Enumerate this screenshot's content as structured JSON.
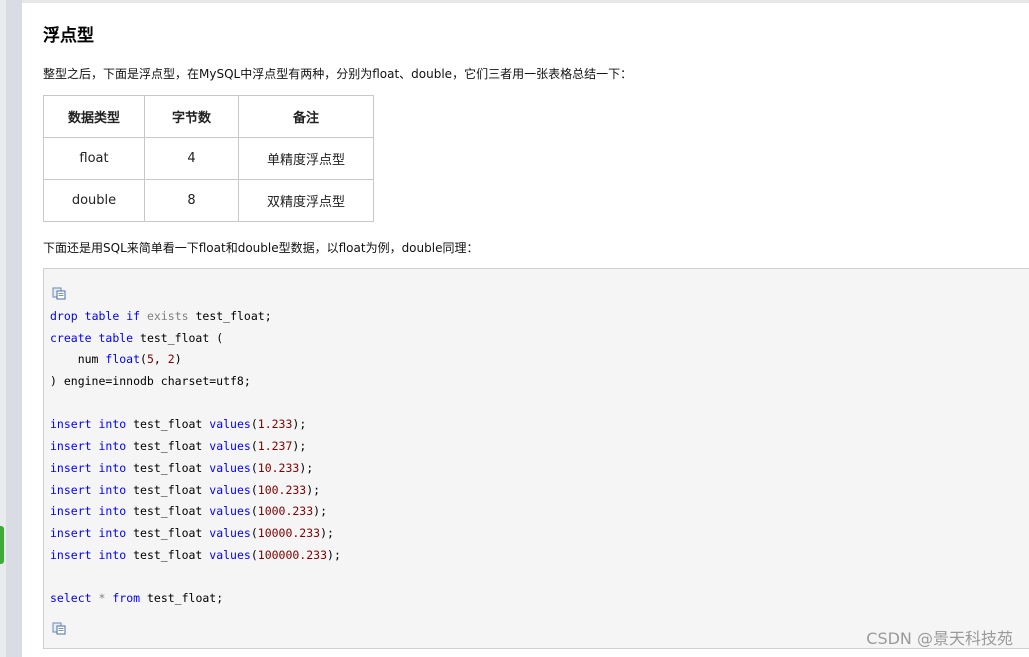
{
  "heading": "浮点型",
  "intro": "整型之后，下面是浮点型，在MySQL中浮点型有两种，分别为float、double，它们三者用一张表格总结一下：",
  "table": {
    "headers": [
      "数据类型",
      "字节数",
      "备注"
    ],
    "rows": [
      [
        "float",
        "4",
        "单精度浮点型"
      ],
      [
        "double",
        "8",
        "双精度浮点型"
      ]
    ]
  },
  "para2": "下面还是用SQL来简单看一下float和double型数据，以float为例，double同理：",
  "code": {
    "lines": [
      [
        {
          "t": "drop",
          "c": "kw"
        },
        {
          "t": " "
        },
        {
          "t": "table",
          "c": "kw"
        },
        {
          "t": " "
        },
        {
          "t": "if",
          "c": "kw"
        },
        {
          "t": " "
        },
        {
          "t": "exists",
          "c": "gray"
        },
        {
          "t": " test_float;"
        }
      ],
      [
        {
          "t": "create",
          "c": "kw"
        },
        {
          "t": " "
        },
        {
          "t": "table",
          "c": "kw"
        },
        {
          "t": " test_float ("
        }
      ],
      [
        {
          "t": "    num "
        },
        {
          "t": "float",
          "c": "kw"
        },
        {
          "t": "("
        },
        {
          "t": "5",
          "c": "num"
        },
        {
          "t": ", "
        },
        {
          "t": "2",
          "c": "num"
        },
        {
          "t": ")"
        }
      ],
      [
        {
          "t": ") engine=innodb charset=utf8;"
        }
      ],
      [],
      [
        {
          "t": "insert",
          "c": "kw"
        },
        {
          "t": " "
        },
        {
          "t": "into",
          "c": "kw"
        },
        {
          "t": " test_float "
        },
        {
          "t": "values",
          "c": "kw"
        },
        {
          "t": "("
        },
        {
          "t": "1.233",
          "c": "num"
        },
        {
          "t": ");"
        }
      ],
      [
        {
          "t": "insert",
          "c": "kw"
        },
        {
          "t": " "
        },
        {
          "t": "into",
          "c": "kw"
        },
        {
          "t": " test_float "
        },
        {
          "t": "values",
          "c": "kw"
        },
        {
          "t": "("
        },
        {
          "t": "1.237",
          "c": "num"
        },
        {
          "t": ");"
        }
      ],
      [
        {
          "t": "insert",
          "c": "kw"
        },
        {
          "t": " "
        },
        {
          "t": "into",
          "c": "kw"
        },
        {
          "t": " test_float "
        },
        {
          "t": "values",
          "c": "kw"
        },
        {
          "t": "("
        },
        {
          "t": "10.233",
          "c": "num"
        },
        {
          "t": ");"
        }
      ],
      [
        {
          "t": "insert",
          "c": "kw"
        },
        {
          "t": " "
        },
        {
          "t": "into",
          "c": "kw"
        },
        {
          "t": " test_float "
        },
        {
          "t": "values",
          "c": "kw"
        },
        {
          "t": "("
        },
        {
          "t": "100.233",
          "c": "num"
        },
        {
          "t": ");"
        }
      ],
      [
        {
          "t": "insert",
          "c": "kw"
        },
        {
          "t": " "
        },
        {
          "t": "into",
          "c": "kw"
        },
        {
          "t": " test_float "
        },
        {
          "t": "values",
          "c": "kw"
        },
        {
          "t": "("
        },
        {
          "t": "1000.233",
          "c": "num"
        },
        {
          "t": ");"
        }
      ],
      [
        {
          "t": "insert",
          "c": "kw"
        },
        {
          "t": " "
        },
        {
          "t": "into",
          "c": "kw"
        },
        {
          "t": " test_float "
        },
        {
          "t": "values",
          "c": "kw"
        },
        {
          "t": "("
        },
        {
          "t": "10000.233",
          "c": "num"
        },
        {
          "t": ");"
        }
      ],
      [
        {
          "t": "insert",
          "c": "kw"
        },
        {
          "t": " "
        },
        {
          "t": "into",
          "c": "kw"
        },
        {
          "t": " test_float "
        },
        {
          "t": "values",
          "c": "kw"
        },
        {
          "t": "("
        },
        {
          "t": "100000.233",
          "c": "num"
        },
        {
          "t": ");"
        }
      ],
      [],
      [
        {
          "t": "select",
          "c": "kw"
        },
        {
          "t": " "
        },
        {
          "t": "*",
          "c": "gray"
        },
        {
          "t": " "
        },
        {
          "t": "from",
          "c": "kw"
        },
        {
          "t": " test_float;"
        }
      ]
    ]
  },
  "icons": {
    "copy_top": "copy-code-icon",
    "copy_bottom": "copy-code-icon"
  },
  "watermark": "CSDN @景天科技苑"
}
